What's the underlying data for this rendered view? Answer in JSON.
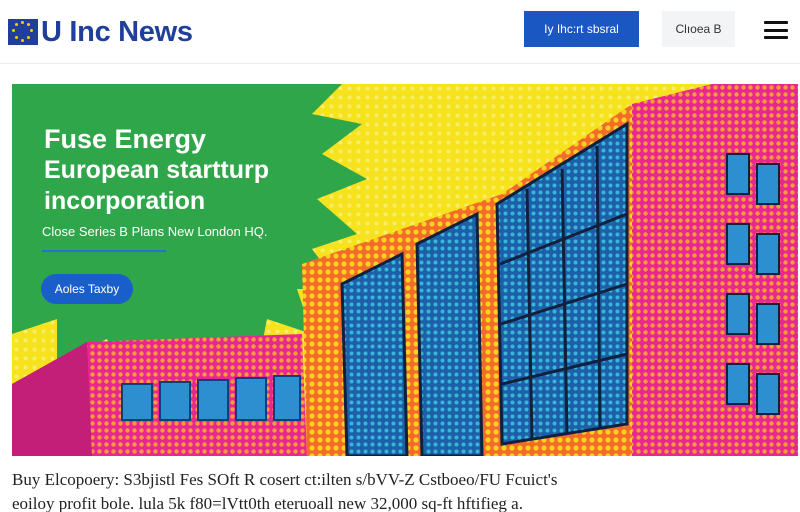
{
  "header": {
    "logo_text": "U Inc News",
    "logo_icon": "eu-flag-icon",
    "primary_button": "Iy Ihc:rt sbsral",
    "secondary_button": "Clıoeа B",
    "menu_icon": "hamburger-menu-icon"
  },
  "hero": {
    "title_line1": "Fuse Energy",
    "title_line2": "European startturp",
    "title_line3": "incorporation",
    "subtitle": "Close Series B Plans New London HQ.",
    "cta_label": "Aoles Taxby"
  },
  "summary": {
    "line1": "Buy Elcopoery: S3bjistl Fes SOft R cosert ct:ilten s/bVV-Z Cstboeo/FU Fcuict's",
    "line2": "eoiloy profit bole. lula 5k f80=lVtt0th eteruoall new 32,000 sq-ft hftifieg a."
  },
  "colors": {
    "brand_blue": "#1f3f99",
    "button_blue": "#1a57c2",
    "hero_green": "#2fa64a",
    "hero_yellow": "#f6e21d",
    "hero_magenta": "#e8278f"
  }
}
